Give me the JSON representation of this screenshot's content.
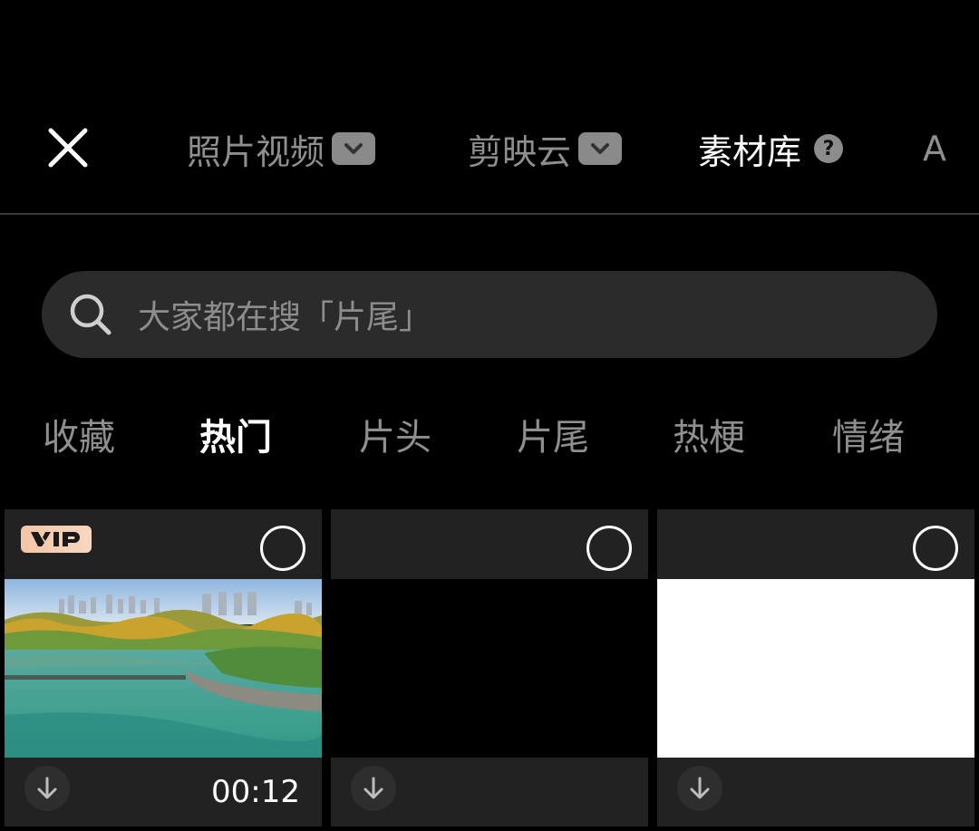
{
  "tabs": {
    "photo_video": "照片视频",
    "cloud": "剪映云",
    "library": "素材库",
    "more": "A"
  },
  "search": {
    "placeholder": "大家都在搜「片尾」"
  },
  "categories": [
    "收藏",
    "热门",
    "片头",
    "片尾",
    "热梗",
    "情绪"
  ],
  "active_category": "热门",
  "badges": {
    "vip": "VIP"
  },
  "items": [
    {
      "type": "landscape-video",
      "vip": true,
      "duration": "00:12"
    },
    {
      "type": "black-clip",
      "vip": false,
      "duration": ""
    },
    {
      "type": "white-clip",
      "vip": false,
      "duration": ""
    }
  ],
  "colors": {
    "background": "#000000",
    "inactive_text": "#8f8f8f",
    "search_bg": "#2b2b2b",
    "card_bg": "#222222",
    "vip_badge": "#f3c6a8"
  }
}
